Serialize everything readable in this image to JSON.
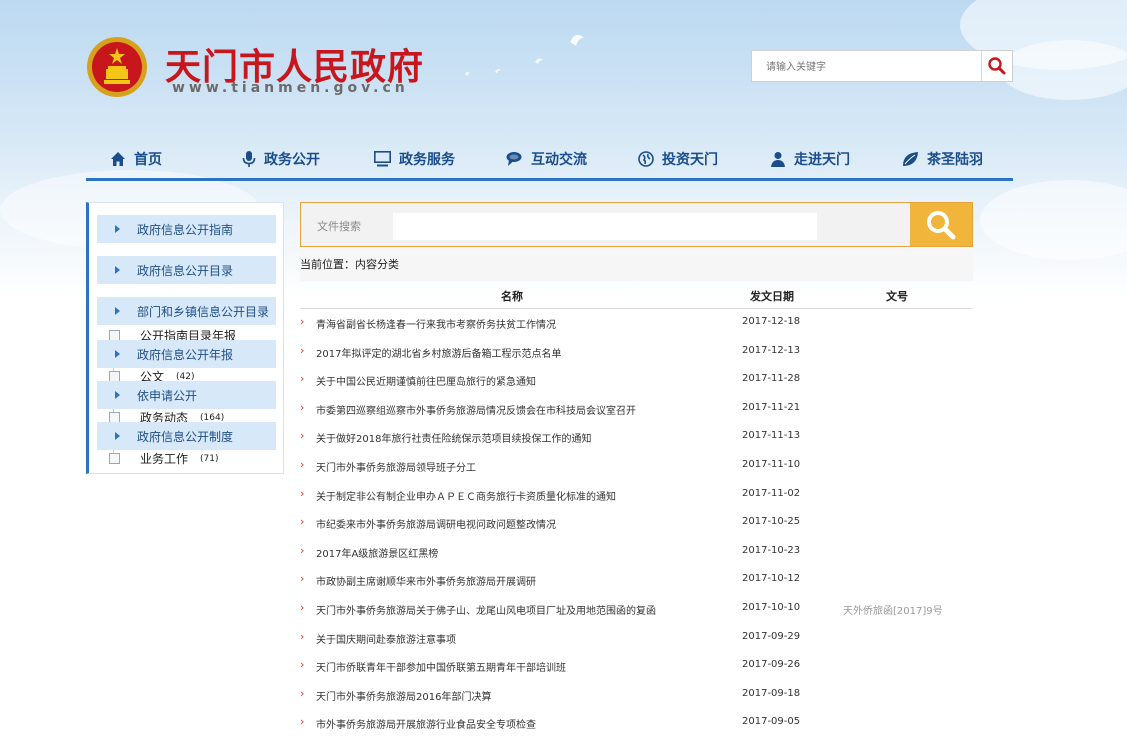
{
  "header": {
    "title": "天门市人民政府",
    "url": "www.tianmen.gov.cn",
    "search_placeholder": "请输入关键字"
  },
  "nav": [
    {
      "label": "首页",
      "icon": "home-icon"
    },
    {
      "label": "政务公开",
      "icon": "microphone-icon"
    },
    {
      "label": "政务服务",
      "icon": "monitor-icon"
    },
    {
      "label": "互动交流",
      "icon": "chat-icon"
    },
    {
      "label": "投资天门",
      "icon": "globe-icon"
    },
    {
      "label": "走进天门",
      "icon": "person-icon"
    },
    {
      "label": "茶圣陆羽",
      "icon": "leaf-icon"
    }
  ],
  "sidebar": {
    "buttons": [
      "政府信息公开指南",
      "政府信息公开目录",
      "部门和乡镇信息公开目录",
      "政府信息公开年报",
      "依申请公开",
      "政府信息公开制度"
    ],
    "tree": [
      {
        "label": "公开指南目录年报",
        "count": ""
      },
      {
        "label": "公文",
        "count": "(42)"
      },
      {
        "label": "政务动态",
        "count": "(164)"
      },
      {
        "label": "业务工作",
        "count": "(71)"
      }
    ]
  },
  "file_search": {
    "label": "文件搜索"
  },
  "breadcrumb": "当前位置：内容分类",
  "table": {
    "headers": {
      "name": "名称",
      "date": "发文日期",
      "docno": "文号"
    },
    "rows": [
      {
        "title": "青海省副省长杨逢春一行来我市考察侨务扶贫工作情况",
        "date": "2017-12-18",
        "docno": ""
      },
      {
        "title": "2017年拟评定的湖北省乡村旅游后备箱工程示范点名单",
        "date": "2017-12-13",
        "docno": ""
      },
      {
        "title": "关于中国公民近期谨慎前往巴厘岛旅行的紧急通知",
        "date": "2017-11-28",
        "docno": ""
      },
      {
        "title": "市委第四巡察组巡察市外事侨务旅游局情况反馈会在市科技局会议室召开",
        "date": "2017-11-21",
        "docno": ""
      },
      {
        "title": "关于做好2018年旅行社责任险统保示范项目续投保工作的通知",
        "date": "2017-11-13",
        "docno": ""
      },
      {
        "title": "天门市外事侨务旅游局领导班子分工",
        "date": "2017-11-10",
        "docno": ""
      },
      {
        "title": "关于制定非公有制企业申办ＡＰＥＣ商务旅行卡资质量化标准的通知",
        "date": "2017-11-02",
        "docno": ""
      },
      {
        "title": "市纪委来市外事侨务旅游局调研电视问政问题整改情况",
        "date": "2017-10-25",
        "docno": ""
      },
      {
        "title": "2017年A级旅游景区红黑榜",
        "date": "2017-10-23",
        "docno": ""
      },
      {
        "title": "市政协副主席谢顺华来市外事侨务旅游局开展调研",
        "date": "2017-10-12",
        "docno": ""
      },
      {
        "title": "天门市外事侨务旅游局关于佛子山、龙尾山风电项目厂址及用地范围函的复函",
        "date": "2017-10-10",
        "docno": "天外侨旅函[2017]9号"
      },
      {
        "title": "关于国庆期间赴泰旅游注意事项",
        "date": "2017-09-29",
        "docno": ""
      },
      {
        "title": "天门市侨联青年干部参加中国侨联第五期青年干部培训班",
        "date": "2017-09-26",
        "docno": ""
      },
      {
        "title": "天门市外事侨务旅游局2016年部门决算",
        "date": "2017-09-18",
        "docno": ""
      },
      {
        "title": "市外事侨务旅游局开展旅游行业食品安全专项检查",
        "date": "2017-09-05",
        "docno": ""
      }
    ]
  }
}
